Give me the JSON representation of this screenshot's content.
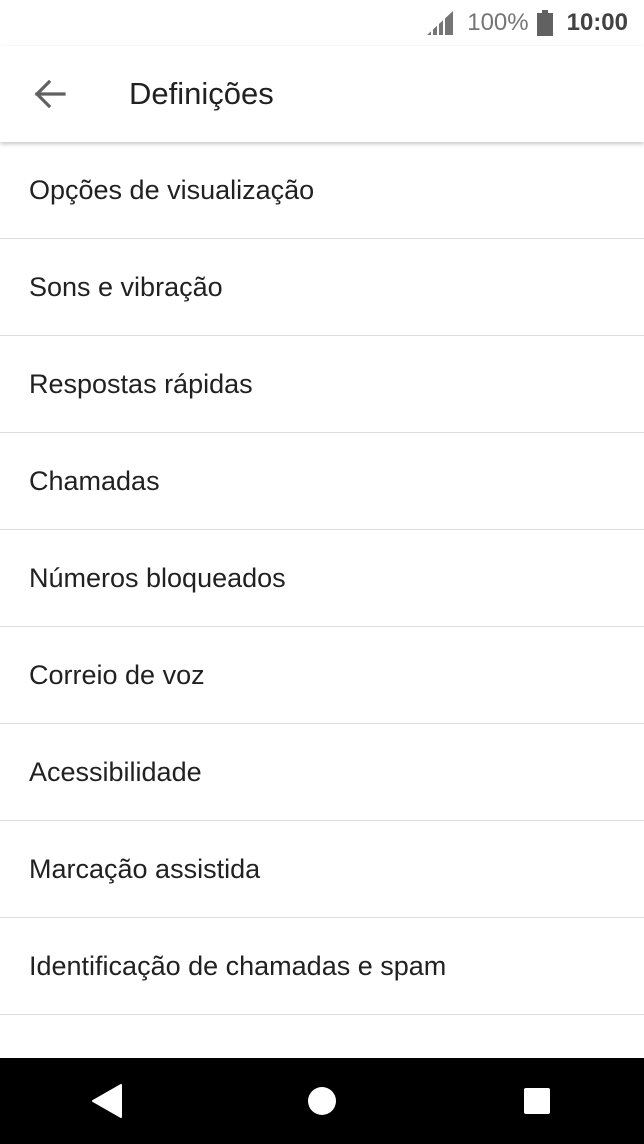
{
  "status_bar": {
    "signal_icon": "cellular-signal-icon",
    "battery_percent": "100%",
    "battery_icon": "battery-full-icon",
    "time": "10:00"
  },
  "app_bar": {
    "back_icon": "arrow-back-icon",
    "title": "Definições"
  },
  "settings": {
    "items": [
      {
        "label": "Opções de visualização"
      },
      {
        "label": "Sons e vibração"
      },
      {
        "label": "Respostas rápidas"
      },
      {
        "label": "Chamadas"
      },
      {
        "label": "Números bloqueados"
      },
      {
        "label": "Correio de voz"
      },
      {
        "label": "Acessibilidade"
      },
      {
        "label": "Marcação assistida"
      },
      {
        "label": "Identificação de chamadas e spam"
      },
      {
        "label": ""
      }
    ]
  },
  "nav_bar": {
    "back_icon": "nav-back-triangle-icon",
    "home_icon": "nav-home-circle-icon",
    "recents_icon": "nav-recents-square-icon"
  },
  "colors": {
    "text_primary": "#212121",
    "status_text": "#757575",
    "divider": "#dcdcdc",
    "nav_bar_bg": "#000000"
  }
}
